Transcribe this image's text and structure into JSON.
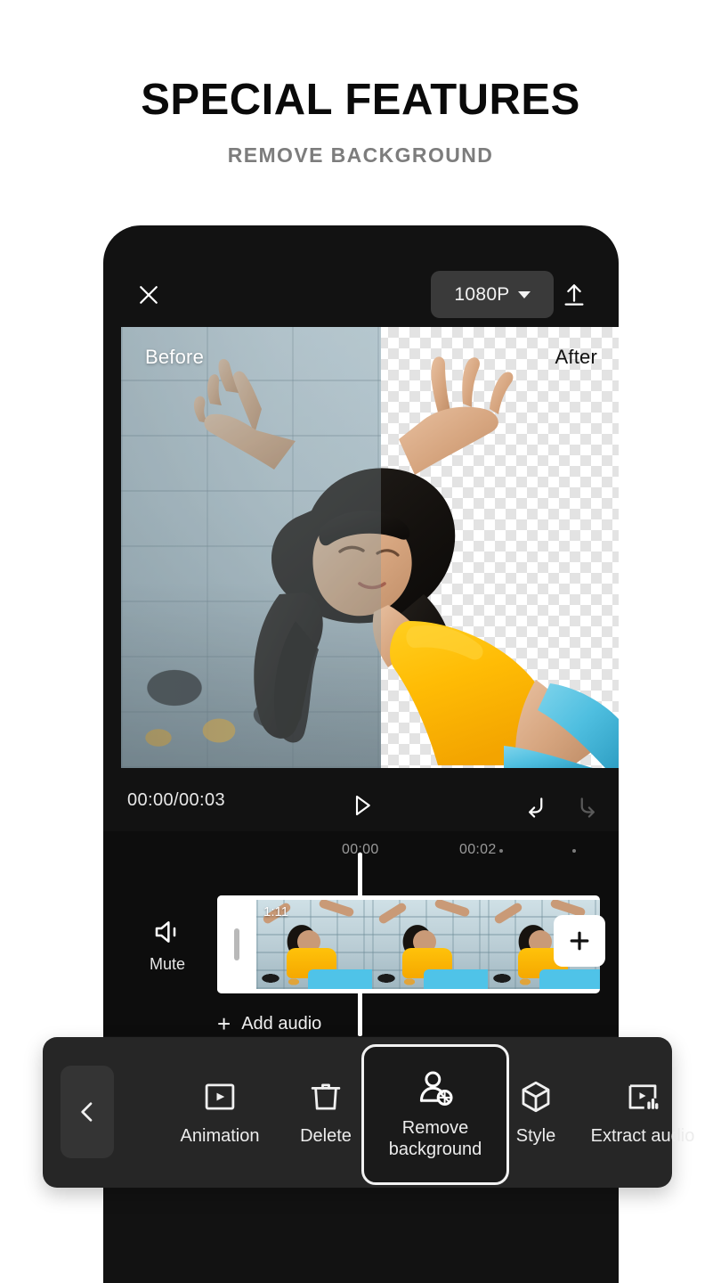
{
  "promo": {
    "title": "SPECIAL FEATURES",
    "subtitle": "REMOVE BACKGROUND"
  },
  "colors": {
    "page_bg": "#ffffff",
    "title": "#0a0a0a",
    "subtitle": "#7d7d7d",
    "app_bg": "#121212",
    "toolbar_bg": "#262626",
    "accent_highlight": "#f2f2f2",
    "checker_light": "#ffffff",
    "checker_dark": "#e3e3e3",
    "top_yellow": "#ffc20a"
  },
  "app": {
    "topbar": {
      "close_icon": "close-icon",
      "resolution_label": "1080P",
      "resolution_caret_icon": "chevron-down-icon",
      "export_icon": "export-upload-icon"
    },
    "preview": {
      "before_label": "Before",
      "after_label": "After",
      "split_position_pct": 52
    },
    "player": {
      "timecode": "00:00/00:03",
      "current_time": "00:00",
      "total_time": "00:03",
      "play_icon": "play-icon",
      "undo_icon": "undo-icon",
      "redo_icon": "redo-icon"
    },
    "timeline": {
      "ruler_ticks": [
        "00:00",
        "·",
        "00:02",
        "·"
      ],
      "playhead_time": "00:00",
      "mute": {
        "label": "Mute",
        "icon": "mute-speaker-icon"
      },
      "clip": {
        "frame_count": 3,
        "time_badge": "1:11",
        "trim_handle_icon": "trim-handle-icon"
      },
      "add_clip_icon": "plus-icon",
      "audio_row": {
        "plus": "+",
        "label": "Add audio"
      }
    },
    "toolbar": {
      "back_icon": "chevron-left-icon",
      "items": [
        {
          "label": "Animation",
          "icon": "animation-icon",
          "selected": false
        },
        {
          "label": "Delete",
          "icon": "trash-icon",
          "selected": false
        },
        {
          "label": "Remove\nbackground",
          "label_line1": "Remove",
          "label_line2": "background",
          "icon": "remove-background-icon",
          "selected": true
        },
        {
          "label": "Style",
          "icon": "cube-icon",
          "selected": false
        },
        {
          "label": "Extract audio",
          "icon": "extract-audio-icon",
          "selected": false
        }
      ]
    }
  }
}
